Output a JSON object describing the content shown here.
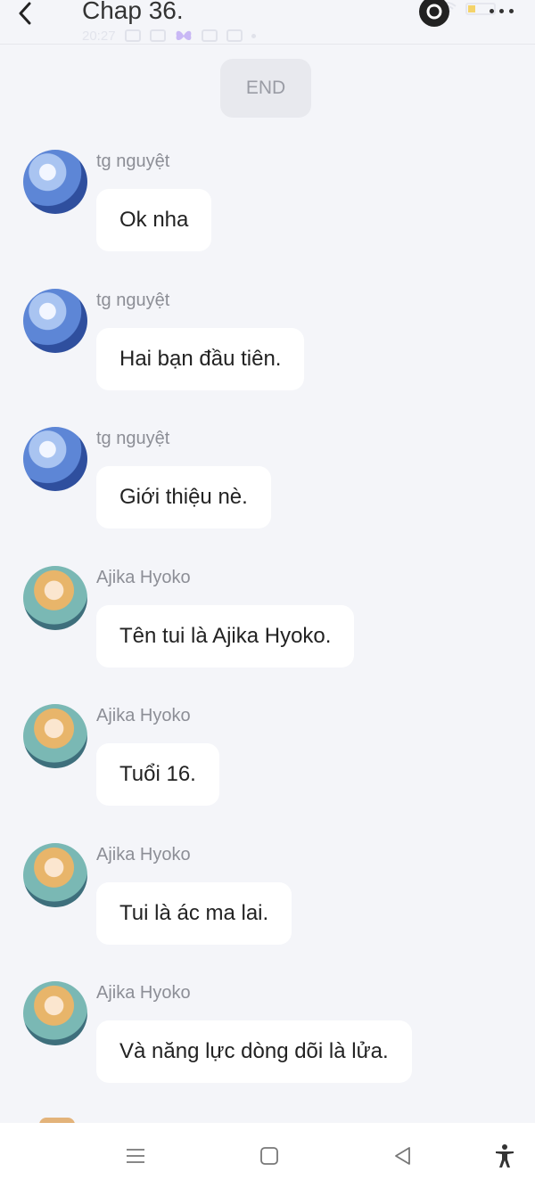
{
  "header": {
    "title": "Chap 36.",
    "status_time": "20:27"
  },
  "end_label": "END",
  "messages": [
    {
      "sender": "tg nguyệt",
      "text": "Ok nha",
      "avatar": "nguyet"
    },
    {
      "sender": "tg nguyệt",
      "text": "Hai bạn đầu tiên.",
      "avatar": "nguyet"
    },
    {
      "sender": "tg nguyệt",
      "text": "Giới thiệu nè.",
      "avatar": "nguyet"
    },
    {
      "sender": "Ajika Hyoko",
      "text": "Tên tui là Ajika Hyoko.",
      "avatar": "hyoko"
    },
    {
      "sender": "Ajika Hyoko",
      "text": "Tuổi 16.",
      "avatar": "hyoko"
    },
    {
      "sender": "Ajika Hyoko",
      "text": "Tui là ác ma lai.",
      "avatar": "hyoko"
    },
    {
      "sender": "Ajika Hyoko",
      "text": "Và năng lực dòng dõi là lửa.",
      "avatar": "hyoko"
    }
  ],
  "icons": {
    "back": "chevron-left-icon",
    "eye": "eye-icon",
    "more": "more-dots-icon",
    "nav_menu": "menu-lines-icon",
    "nav_home": "square-home-icon",
    "nav_back": "triangle-back-icon",
    "nav_accessibility": "accessibility-icon"
  }
}
